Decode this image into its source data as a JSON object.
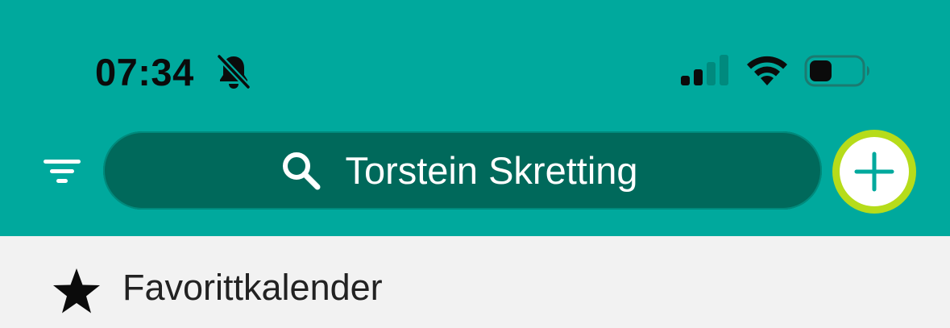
{
  "status_bar": {
    "time": "07:34",
    "silent_icon": "bell-slash-icon",
    "signal_icon": "cellular-signal-icon",
    "wifi_icon": "wifi-icon",
    "battery_icon": "battery-low-icon"
  },
  "header": {
    "filter_icon": "filter-icon",
    "search": {
      "icon": "search-icon",
      "value": "Torstein Skretting"
    },
    "add_icon": "plus-icon"
  },
  "list": {
    "items": [
      {
        "icon": "star-icon",
        "label": "Favorittkalender"
      }
    ]
  },
  "colors": {
    "header_bg": "#00a99d",
    "search_bg": "#00695b",
    "add_ring": "#b6dc1a",
    "add_plus": "#00a99d",
    "list_bg": "#f2f2f2"
  }
}
